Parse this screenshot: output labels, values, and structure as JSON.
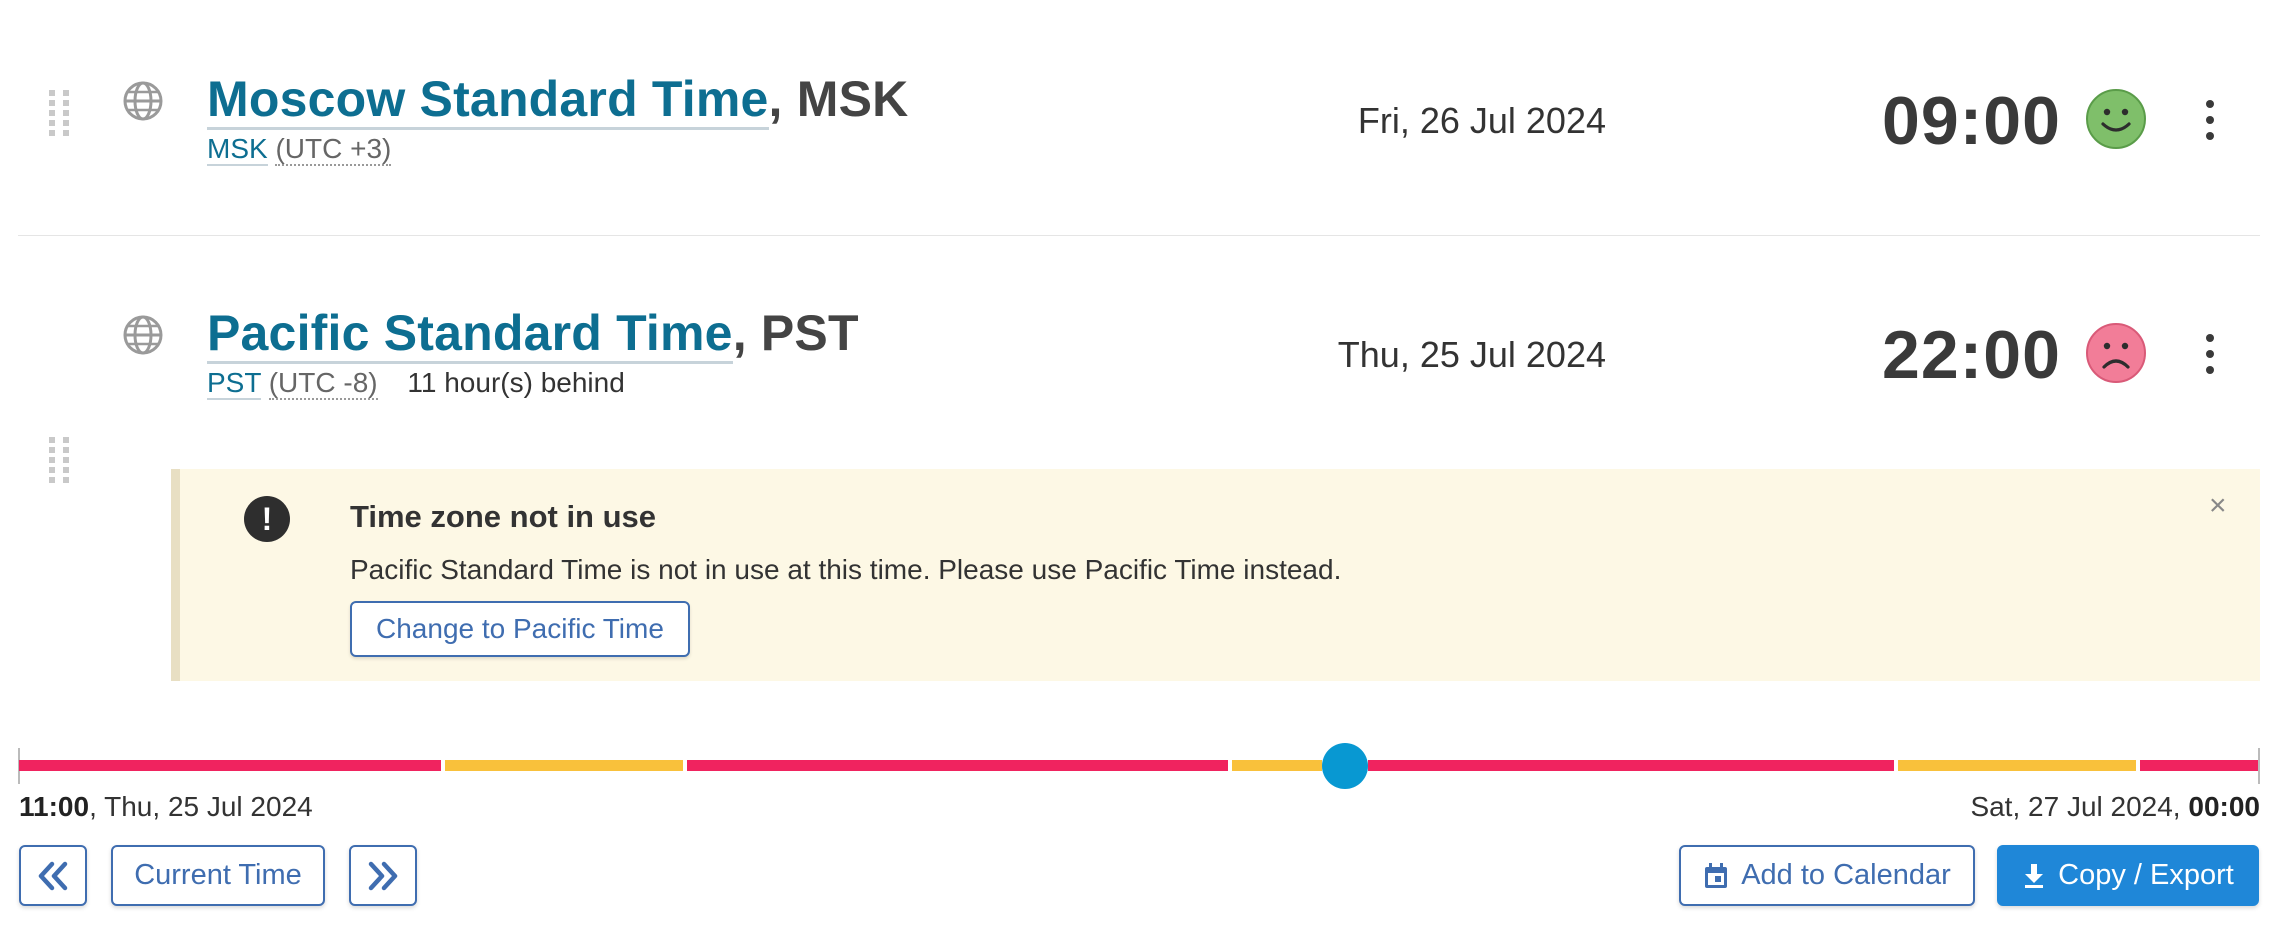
{
  "rows": [
    {
      "name": "Moscow Standard Time",
      "abbr_suffix": ", MSK",
      "abbr": "MSK",
      "utc": "(UTC +3)",
      "offset_text": "",
      "date": "Fri, 26 Jul 2024",
      "time": "09:00",
      "mood": "happy",
      "mood_color": "#7fbf6a"
    },
    {
      "name": "Pacific Standard Time",
      "abbr_suffix": ", PST",
      "abbr": "PST",
      "utc": "(UTC -8)",
      "offset_text": "11 hour(s) behind",
      "date": "Thu, 25 Jul 2024",
      "time": "22:00",
      "mood": "sad",
      "mood_color": "#f27d98"
    }
  ],
  "alert": {
    "title": "Time zone not in use",
    "message": "Pacific Standard Time is not in use at this time. Please use Pacific Time instead.",
    "button_label": "Change to Pacific Time",
    "close_glyph": "×"
  },
  "timeline": {
    "start_time": "11:00",
    "start_date": ", Thu, 25 Jul 2024",
    "end_date": "Sat, 27 Jul 2024, ",
    "end_time": "00:00",
    "colors": {
      "night": "#f0235f",
      "transition": "#f9c13b",
      "knob": "#0898d2"
    }
  },
  "buttons": {
    "prev_icon": "double-chevron-left-icon",
    "current_time": "Current Time",
    "next_icon": "double-chevron-right-icon",
    "add_calendar": "Add to Calendar",
    "copy_export": "Copy / Export"
  },
  "icons": {
    "globe": "globe-icon",
    "drag": "drag-handle-icon",
    "kebab": "more-options-icon",
    "alert": "exclamation-circle-icon",
    "calendar": "calendar-icon",
    "download": "download-icon"
  }
}
